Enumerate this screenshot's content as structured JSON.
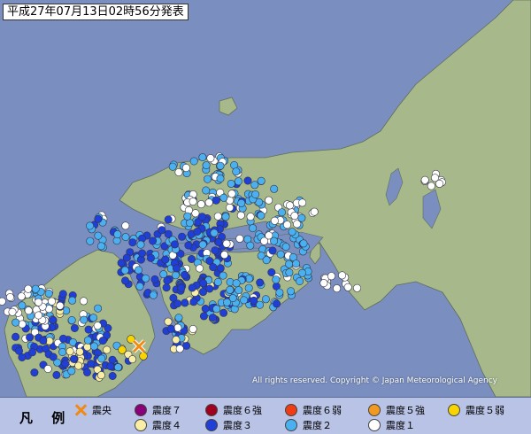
{
  "header": {
    "title": "平成27年07月13日02時56分発表"
  },
  "map": {
    "copyright": "All rights reserved. Copyright © Japan Meteorological Agency",
    "sea_color": "#7b8ec0",
    "land_color": "#a7b98b",
    "epicenter_icon": "x-mark-icon",
    "intensity_colors": {
      "1": "#ffffff",
      "2": "#4ab0f0",
      "3": "#1f3fd6",
      "4": "#f8eea6",
      "5-": "#f8d400",
      "5+": "#f29a1f",
      "6-": "#f03c14",
      "6+": "#a00020",
      "7": "#8a007a"
    }
  },
  "legend": {
    "title": "凡 例",
    "items": [
      {
        "label": "震央",
        "icon": "x-mark-icon"
      },
      {
        "label": "震度７",
        "color": "#8a007a"
      },
      {
        "label": "震度６強",
        "color": "#a00020"
      },
      {
        "label": "震度６弱",
        "color": "#f03c14"
      },
      {
        "label": "震度５強",
        "color": "#f29a1f"
      },
      {
        "label": "震度５弱",
        "color": "#f8d400"
      },
      {
        "label": "震度４",
        "color": "#f8eea6"
      },
      {
        "label": "震度３",
        "color": "#1f3fd6"
      },
      {
        "label": "震度２",
        "color": "#4ab0f0"
      },
      {
        "label": "震度１",
        "color": "#ffffff"
      }
    ]
  }
}
